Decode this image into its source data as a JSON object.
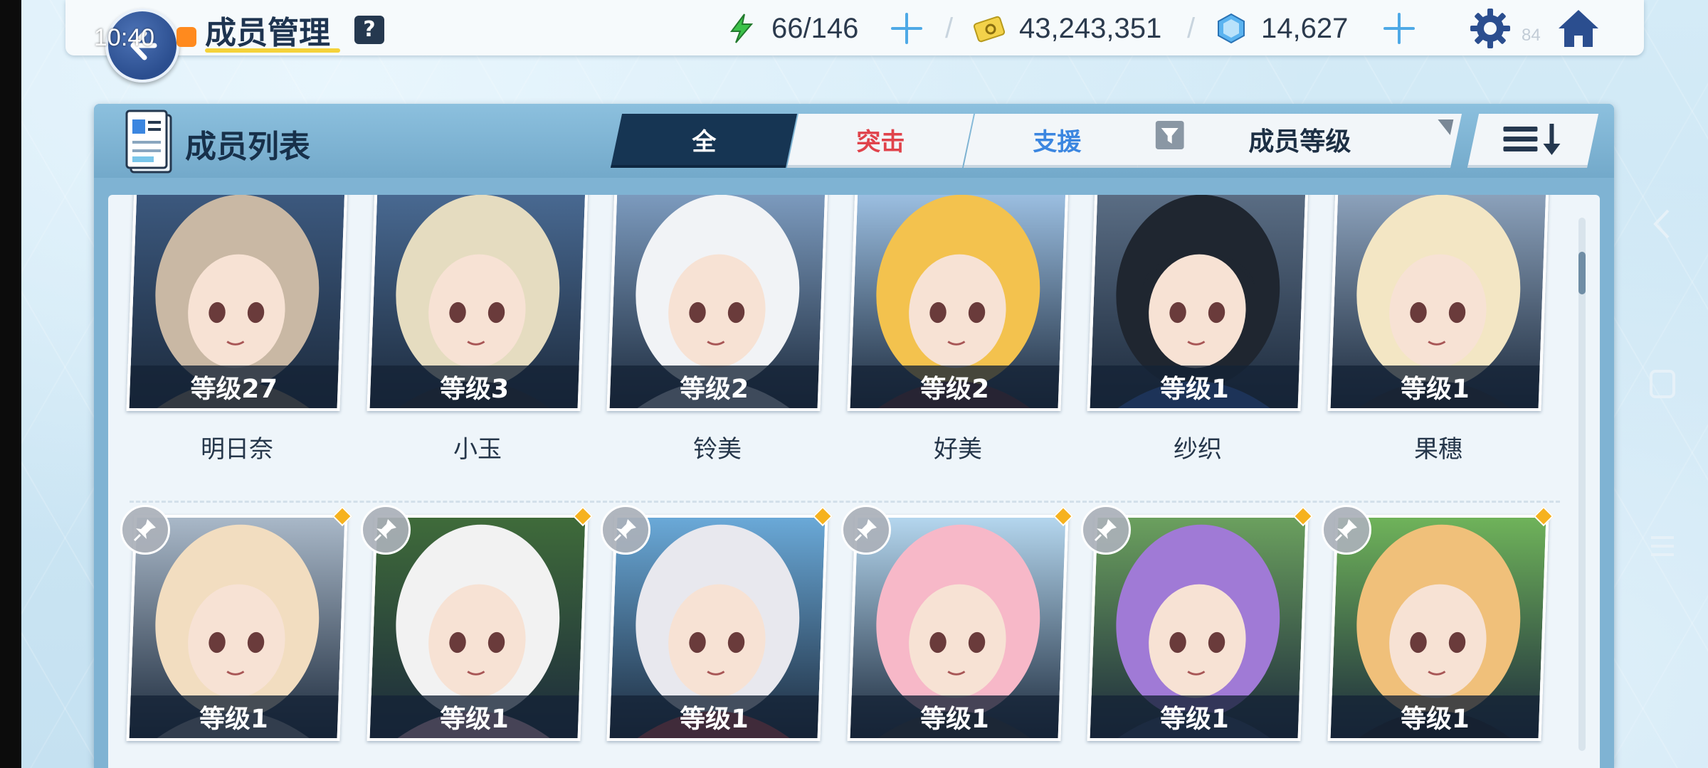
{
  "status": {
    "time": "10:40"
  },
  "header": {
    "title": "成员管理",
    "help_label": "?",
    "ap": "66/146",
    "credits": "43,243,351",
    "gems": "14,627",
    "faint_number": "84"
  },
  "panel": {
    "title": "成员列表",
    "tabs": [
      {
        "label": "全",
        "selected": true
      },
      {
        "label": "突击",
        "selected": false
      },
      {
        "label": "支援",
        "selected": false
      }
    ],
    "sort_label": "成员等级"
  },
  "members_row1": [
    {
      "level": "等级27",
      "name": "明日奈",
      "palette": [
        "#3d5a80",
        "#c9b8a4",
        "#a0876a"
      ]
    },
    {
      "level": "等级3",
      "name": "小玉",
      "palette": [
        "#4a6b94",
        "#e5dcc0",
        "#2c2c30"
      ]
    },
    {
      "level": "等级2",
      "name": "铃美",
      "palette": [
        "#7f9ec2",
        "#f1f3f6",
        "#cfd6dd"
      ]
    },
    {
      "level": "等级2",
      "name": "好美",
      "palette": [
        "#9fc3e6",
        "#f3c24e",
        "#6b2c2c"
      ]
    },
    {
      "level": "等级1",
      "name": "纱织",
      "palette": [
        "#5c6f86",
        "#1f2630",
        "#3b6fd1"
      ]
    },
    {
      "level": "等级1",
      "name": "果穗",
      "palette": [
        "#8fa5bf",
        "#f3e6c4",
        "#2a2a30"
      ]
    }
  ],
  "members_row2": [
    {
      "level": "等级1",
      "name": "",
      "palette": [
        "#a9b8c8",
        "#f2ddc0",
        "#9a9aa0"
      ]
    },
    {
      "level": "等级1",
      "name": "",
      "palette": [
        "#3f6b3a",
        "#f2f2f2",
        "#f4b6c8"
      ]
    },
    {
      "level": "等级1",
      "name": "",
      "palette": [
        "#6aa9d8",
        "#e8e8ee",
        "#d94a4a"
      ]
    },
    {
      "level": "等级1",
      "name": "",
      "palette": [
        "#b4d6ee",
        "#f7b8c8",
        "#3a3a3a"
      ]
    },
    {
      "level": "等级1",
      "name": "",
      "palette": [
        "#6ba05e",
        "#a07ad6",
        "#3a4a6a"
      ]
    },
    {
      "level": "等级1",
      "name": "",
      "palette": [
        "#6fb35a",
        "#f0c07a",
        "#1c1c22"
      ]
    }
  ],
  "colors": {
    "accent_dark": "#163553",
    "striker": "#e0434b",
    "special": "#3b86e0",
    "ap": "#3cc24a",
    "diamond": "#f6b21e"
  },
  "icons": [
    "back-icon",
    "help-icon",
    "ap-bolt-icon",
    "credit-card-icon",
    "gem-icon",
    "plus-icon",
    "settings-icon",
    "home-icon",
    "member-list-icon",
    "filter-icon",
    "sort-order-icon",
    "pin-icon"
  ]
}
